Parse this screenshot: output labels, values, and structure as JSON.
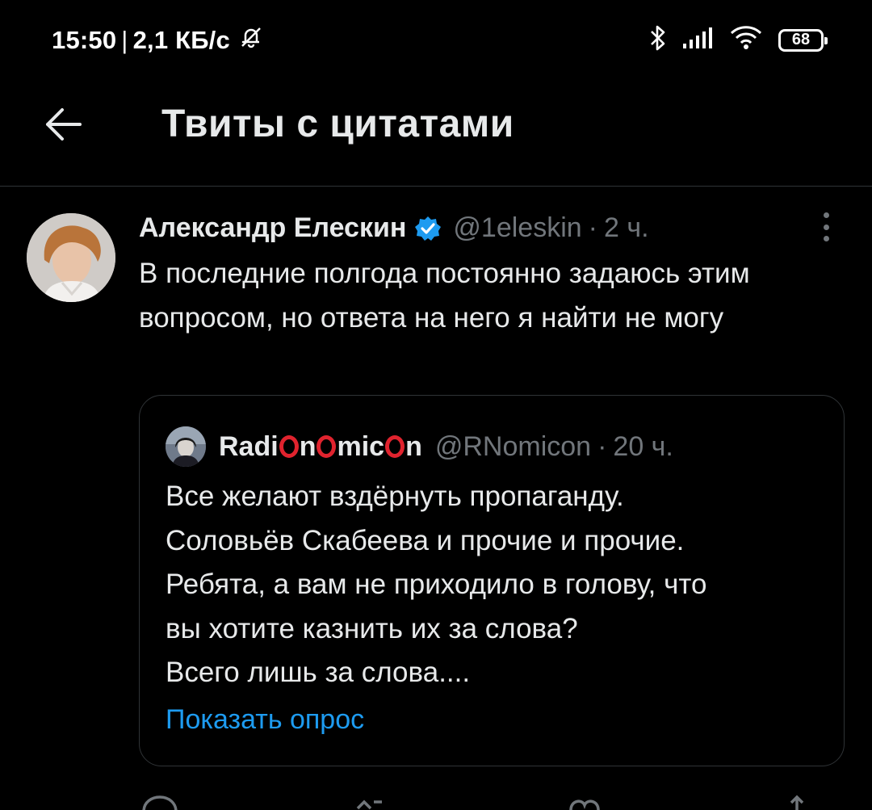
{
  "status_bar": {
    "time": "15:50",
    "separator": "|",
    "net_speed": "2,1 КБ/с",
    "battery": "68",
    "icons": [
      "silent-bell-icon",
      "bluetooth-icon",
      "signal-icon",
      "wifi-icon",
      "battery-icon"
    ]
  },
  "header": {
    "title": "Твиты с цитатами",
    "back_icon": "arrow-left-icon"
  },
  "tweet": {
    "author_name": "Александр Елескин",
    "handle": "@1eleskin",
    "dot": "·",
    "time": "2 ч.",
    "text": "В последние полгода постоянно задаюсь этим вопросом, но ответа на него я найти не могу",
    "quoted": {
      "name_part1": "Radi",
      "name_part2": "n",
      "name_part3": "mic",
      "name_part4": "n",
      "handle": "@RNomicon",
      "dot": "·",
      "time": "20 ч.",
      "lines": [
        "Все желают вздёрнуть пропаганду.",
        "Соловьёв Скабеева и прочие и прочие.",
        "Ребята, а вам не приходило в голову, что",
        "вы хотите казнить их за слова?",
        "Всего лишь за слова...."
      ],
      "show_poll": "Показать опрос"
    }
  },
  "colors": {
    "background": "#000000",
    "text": "#e7e9ea",
    "muted": "#71767b",
    "accent": "#1d9bf0",
    "ring": "#e0232e"
  }
}
